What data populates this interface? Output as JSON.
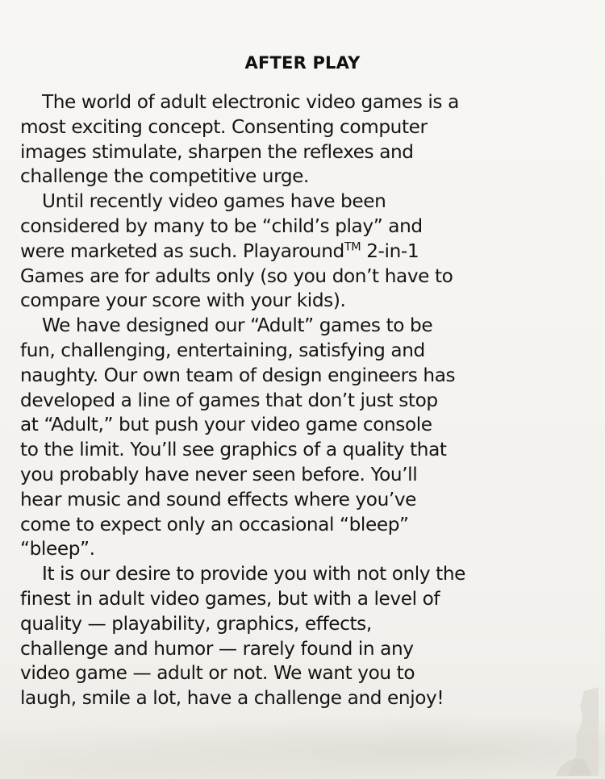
{
  "title": "AFTER PLAY",
  "lines": [
    {
      "text": "The world of adult electronic video games is a",
      "indent": true
    },
    {
      "text": "most exciting concept. Consenting computer",
      "indent": false
    },
    {
      "text": "images stimulate, sharpen the reflexes and",
      "indent": false
    },
    {
      "text": "challenge the competitive urge.",
      "indent": false
    },
    {
      "text": "Until recently video games have been",
      "indent": true
    },
    {
      "text": "considered by many to be “child’s play” and",
      "indent": false
    },
    {
      "text_before_tm": "were marketed as such. Playaround",
      "tm": "TM",
      "text_after_tm": " 2-in-1",
      "indent": false
    },
    {
      "text": "Games are for adults only (so you don’t have to",
      "indent": false
    },
    {
      "text": "compare your score with your kids).",
      "indent": false
    },
    {
      "text": "We have designed our “Adult” games to be",
      "indent": true
    },
    {
      "text": "fun, challenging, entertaining, satisfying and",
      "indent": false
    },
    {
      "text": "naughty. Our own team of design engineers has",
      "indent": false
    },
    {
      "text": "developed a line of games that don’t just stop",
      "indent": false
    },
    {
      "text": "at “Adult,” but push your video game console",
      "indent": false
    },
    {
      "text": "to the limit. You’ll see graphics of a quality that",
      "indent": false
    },
    {
      "text": "you probably have never seen before. You’ll",
      "indent": false
    },
    {
      "text": "hear music and sound effects where you’ve",
      "indent": false
    },
    {
      "text": "come to expect only an occasional “bleep”",
      "indent": false
    },
    {
      "text": "“bleep”.",
      "indent": false
    },
    {
      "text": "It is our desire to provide you with not only the",
      "indent": true
    },
    {
      "text": "finest in adult video games, but with a level of",
      "indent": false
    },
    {
      "text": "quality — playability, graphics, effects,",
      "indent": false
    },
    {
      "text": "challenge and humor — rarely found in any",
      "indent": false
    },
    {
      "text": "video game — adult or not. We want you to",
      "indent": false
    },
    {
      "text": "laugh, smile a lot, have a challenge and enjoy!",
      "indent": false
    }
  ]
}
